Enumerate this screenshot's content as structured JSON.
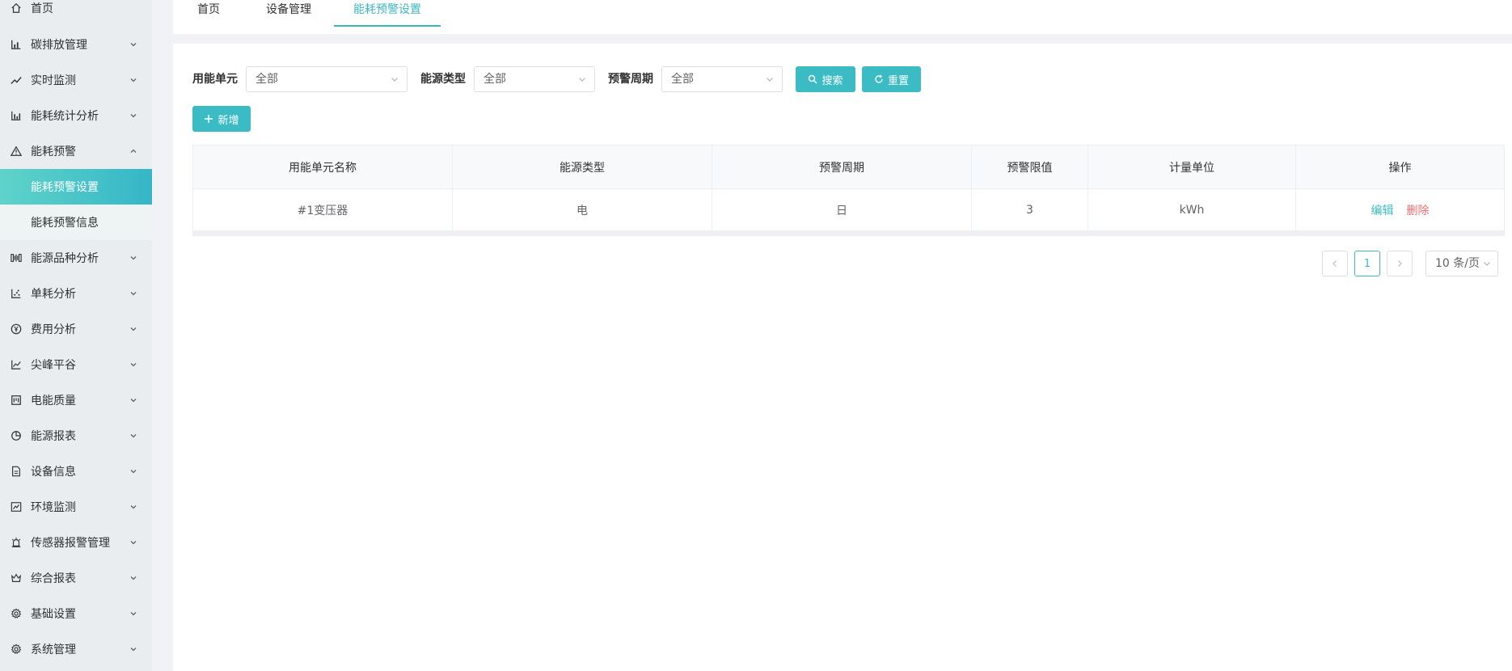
{
  "sidebar": {
    "home": "首页",
    "items": [
      {
        "label": "碳排放管理",
        "icon": "bar-chart-icon"
      },
      {
        "label": "实时监测",
        "icon": "trend-line-icon"
      },
      {
        "label": "能耗统计分析",
        "icon": "column-chart-icon"
      },
      {
        "label": "能耗预警",
        "icon": "warning-triangle-icon"
      },
      {
        "label": "能源品种分析",
        "icon": "energy-variety-icon"
      },
      {
        "label": "单耗分析",
        "icon": "scatter-chart-icon"
      },
      {
        "label": "费用分析",
        "icon": "yen-coin-icon"
      },
      {
        "label": "尖峰平谷",
        "icon": "line-chart-icon"
      },
      {
        "label": "电能质量",
        "icon": "quality-panel-icon"
      },
      {
        "label": "能源报表",
        "icon": "pie-chart-icon"
      },
      {
        "label": "设备信息",
        "icon": "document-icon"
      },
      {
        "label": "环境监测",
        "icon": "monitor-chart-icon"
      },
      {
        "label": "传感器报警管理",
        "icon": "alarm-light-icon"
      },
      {
        "label": "综合报表",
        "icon": "crown-report-icon"
      },
      {
        "label": "基础设置",
        "icon": "gear-icon"
      },
      {
        "label": "系统管理",
        "icon": "gear-icon"
      }
    ],
    "subitems": [
      "能耗预警设置",
      "能耗预警信息"
    ]
  },
  "tabs": [
    "首页",
    "设备管理",
    "能耗预警设置"
  ],
  "filters": {
    "unit_label": "用能单元",
    "unit_value": "全部",
    "energy_label": "能源类型",
    "energy_value": "全部",
    "period_label": "预警周期",
    "period_value": "全部",
    "search": "搜索",
    "reset": "重置",
    "add": "新增"
  },
  "table": {
    "headers": [
      "用能单元名称",
      "能源类型",
      "预警周期",
      "预警限值",
      "计量单位",
      "操作"
    ],
    "rows": [
      [
        "#1变压器",
        "电",
        "日",
        "3",
        "kWh"
      ]
    ],
    "edit": "编辑",
    "delete": "删除"
  },
  "pager": {
    "page": "1",
    "size": "10 条/页"
  },
  "colors": {
    "accent": "#3bbcc4",
    "danger": "#f56c6c",
    "sidebar_bg": "#e9edf0"
  }
}
